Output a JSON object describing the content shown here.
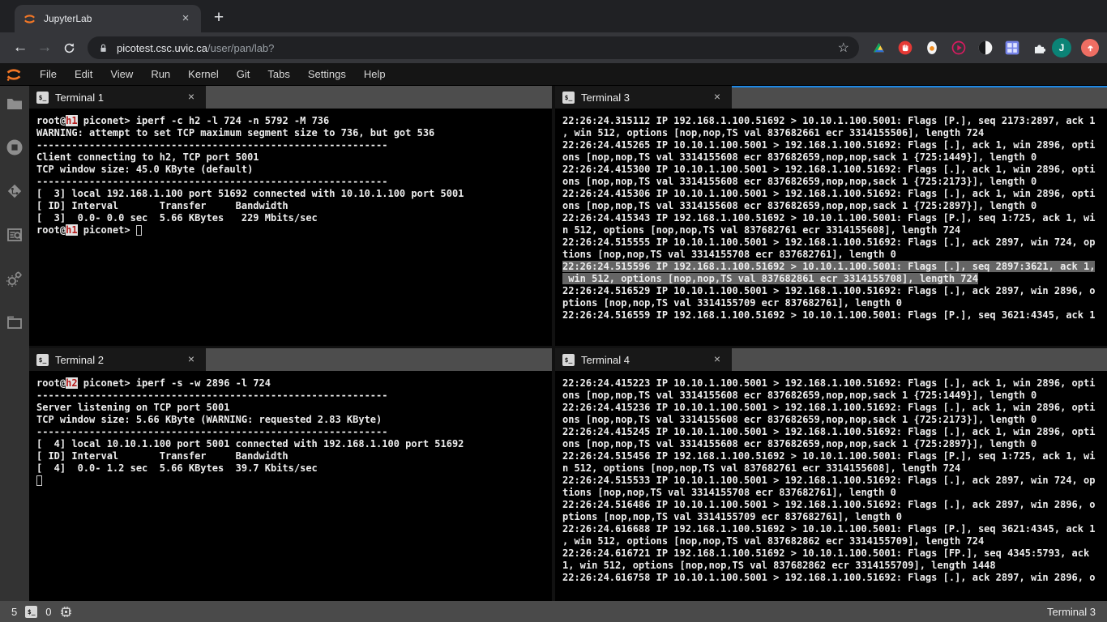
{
  "browser": {
    "tab_title": "JupyterLab",
    "close_glyph": "×",
    "new_tab_glyph": "+",
    "back_glyph": "←",
    "forward_glyph": "→",
    "url_domain": "picotest.csc.uvic.ca",
    "url_path": "/user/pan/lab?",
    "bookmark_star_glyph": "☆",
    "avatar_initial": "J"
  },
  "menubar": {
    "items": [
      "File",
      "Edit",
      "View",
      "Run",
      "Kernel",
      "Git",
      "Tabs",
      "Settings",
      "Help"
    ]
  },
  "sidebar": {
    "icons": [
      "file-browser",
      "running-sessions",
      "git",
      "property-inspector",
      "extension-manager",
      "open-tabs"
    ]
  },
  "icons": {
    "terminal_glyph": "$_"
  },
  "colors": {
    "accent_blue": "#1e88e5",
    "jupyter_orange": "#f37726",
    "host_red": "#b71c1c"
  },
  "panels": [
    {
      "title": "Terminal 1",
      "active": false,
      "lines": [
        {
          "spans": [
            {
              "t": "root@"
            },
            {
              "t": "h1",
              "c": "host"
            },
            {
              "t": " piconet> iperf -c h2 -l 724 -n 5792 -M 736"
            }
          ]
        },
        {
          "t": "WARNING: attempt to set TCP maximum segment size to 736, but got 536"
        },
        {
          "t": "------------------------------------------------------------"
        },
        {
          "t": "Client connecting to h2, TCP port 5001"
        },
        {
          "t": "TCP window size: 45.0 KByte (default)"
        },
        {
          "t": "------------------------------------------------------------"
        },
        {
          "t": "[  3] local 192.168.1.100 port 51692 connected with 10.10.1.100 port 5001"
        },
        {
          "t": "[ ID] Interval       Transfer     Bandwidth"
        },
        {
          "t": "[  3]  0.0- 0.0 sec  5.66 KBytes   229 Mbits/sec"
        },
        {
          "spans": [
            {
              "t": "root@"
            },
            {
              "t": "h1",
              "c": "host"
            },
            {
              "t": " piconet> "
            },
            {
              "t": " ",
              "c": "cursor"
            }
          ]
        }
      ]
    },
    {
      "title": "Terminal 2",
      "active": false,
      "lines": [
        {
          "spans": [
            {
              "t": "root@"
            },
            {
              "t": "h2",
              "c": "host"
            },
            {
              "t": " piconet> iperf -s -w 2896 -l 724"
            }
          ]
        },
        {
          "t": "------------------------------------------------------------"
        },
        {
          "t": "Server listening on TCP port 5001"
        },
        {
          "t": "TCP window size: 5.66 KByte (WARNING: requested 2.83 KByte)"
        },
        {
          "t": "------------------------------------------------------------"
        },
        {
          "t": "[  4] local 10.10.1.100 port 5001 connected with 192.168.1.100 port 51692"
        },
        {
          "t": "[ ID] Interval       Transfer     Bandwidth"
        },
        {
          "t": "[  4]  0.0- 1.2 sec  5.66 KBytes  39.7 Kbits/sec"
        },
        {
          "spans": [
            {
              "t": " ",
              "c": "cursor"
            }
          ]
        }
      ]
    },
    {
      "title": "Terminal 3",
      "active": true,
      "lines": [
        {
          "t": "22:26:24.315112 IP 192.168.1.100.51692 > 10.10.1.100.5001: Flags [P.], seq 2173:2897, ack 1"
        },
        {
          "t": ", win 512, options [nop,nop,TS val 837682661 ecr 3314155506], length 724"
        },
        {
          "t": "22:26:24.415265 IP 10.10.1.100.5001 > 192.168.1.100.51692: Flags [.], ack 1, win 2896, opti"
        },
        {
          "t": "ons [nop,nop,TS val 3314155608 ecr 837682659,nop,nop,sack 1 {725:1449}], length 0"
        },
        {
          "t": "22:26:24.415300 IP 10.10.1.100.5001 > 192.168.1.100.51692: Flags [.], ack 1, win 2896, opti"
        },
        {
          "t": "ons [nop,nop,TS val 3314155608 ecr 837682659,nop,nop,sack 1 {725:2173}], length 0"
        },
        {
          "t": "22:26:24.415306 IP 10.10.1.100.5001 > 192.168.1.100.51692: Flags [.], ack 1, win 2896, opti"
        },
        {
          "t": "ons [nop,nop,TS val 3314155608 ecr 837682659,nop,nop,sack 1 {725:2897}], length 0"
        },
        {
          "t": "22:26:24.415343 IP 192.168.1.100.51692 > 10.10.1.100.5001: Flags [P.], seq 1:725, ack 1, wi"
        },
        {
          "t": "n 512, options [nop,nop,TS val 837682761 ecr 3314155608], length 724"
        },
        {
          "t": "22:26:24.515555 IP 10.10.1.100.5001 > 192.168.1.100.51692: Flags [.], ack 2897, win 724, op"
        },
        {
          "t": "tions [nop,nop,TS val 3314155708 ecr 837682761], length 0"
        },
        {
          "t": "22:26:24.515596 IP 192.168.1.100.51692 > 10.10.1.100.5001: Flags [.], seq 2897:3621, ack 1,",
          "c": "sel"
        },
        {
          "t": " win 512, options [nop,nop,TS val 837682861 ecr 3314155708], length 724",
          "c": "sel"
        },
        {
          "t": "22:26:24.516529 IP 10.10.1.100.5001 > 192.168.1.100.51692: Flags [.], ack 2897, win 2896, o"
        },
        {
          "t": "ptions [nop,nop,TS val 3314155709 ecr 837682761], length 0"
        },
        {
          "t": "22:26:24.516559 IP 192.168.1.100.51692 > 10.10.1.100.5001: Flags [P.], seq 3621:4345, ack 1"
        }
      ]
    },
    {
      "title": "Terminal 4",
      "active": false,
      "lines": [
        {
          "t": "22:26:24.415223 IP 10.10.1.100.5001 > 192.168.1.100.51692: Flags [.], ack 1, win 2896, opti"
        },
        {
          "t": "ons [nop,nop,TS val 3314155608 ecr 837682659,nop,nop,sack 1 {725:1449}], length 0"
        },
        {
          "t": "22:26:24.415236 IP 10.10.1.100.5001 > 192.168.1.100.51692: Flags [.], ack 1, win 2896, opti"
        },
        {
          "t": "ons [nop,nop,TS val 3314155608 ecr 837682659,nop,nop,sack 1 {725:2173}], length 0"
        },
        {
          "t": "22:26:24.415245 IP 10.10.1.100.5001 > 192.168.1.100.51692: Flags [.], ack 1, win 2896, opti"
        },
        {
          "t": "ons [nop,nop,TS val 3314155608 ecr 837682659,nop,nop,sack 1 {725:2897}], length 0"
        },
        {
          "t": "22:26:24.515456 IP 192.168.1.100.51692 > 10.10.1.100.5001: Flags [P.], seq 1:725, ack 1, wi"
        },
        {
          "t": "n 512, options [nop,nop,TS val 837682761 ecr 3314155608], length 724"
        },
        {
          "t": "22:26:24.515533 IP 10.10.1.100.5001 > 192.168.1.100.51692: Flags [.], ack 2897, win 724, op"
        },
        {
          "t": "tions [nop,nop,TS val 3314155708 ecr 837682761], length 0"
        },
        {
          "t": "22:26:24.516486 IP 10.10.1.100.5001 > 192.168.1.100.51692: Flags [.], ack 2897, win 2896, o"
        },
        {
          "t": "ptions [nop,nop,TS val 3314155709 ecr 837682761], length 0"
        },
        {
          "t": "22:26:24.616688 IP 192.168.1.100.51692 > 10.10.1.100.5001: Flags [P.], seq 3621:4345, ack 1"
        },
        {
          "t": ", win 512, options [nop,nop,TS val 837682862 ecr 3314155709], length 724"
        },
        {
          "t": "22:26:24.616721 IP 192.168.1.100.51692 > 10.10.1.100.5001: Flags [FP.], seq 4345:5793, ack"
        },
        {
          "t": "1, win 512, options [nop,nop,TS val 837682862 ecr 3314155709], length 1448"
        },
        {
          "t": "22:26:24.616758 IP 10.10.1.100.5001 > 192.168.1.100.51692: Flags [.], ack 2897, win 2896, o"
        }
      ]
    }
  ],
  "statusbar": {
    "terminals_count": "5",
    "kernels_count": "0",
    "current_tab": "Terminal 3"
  }
}
